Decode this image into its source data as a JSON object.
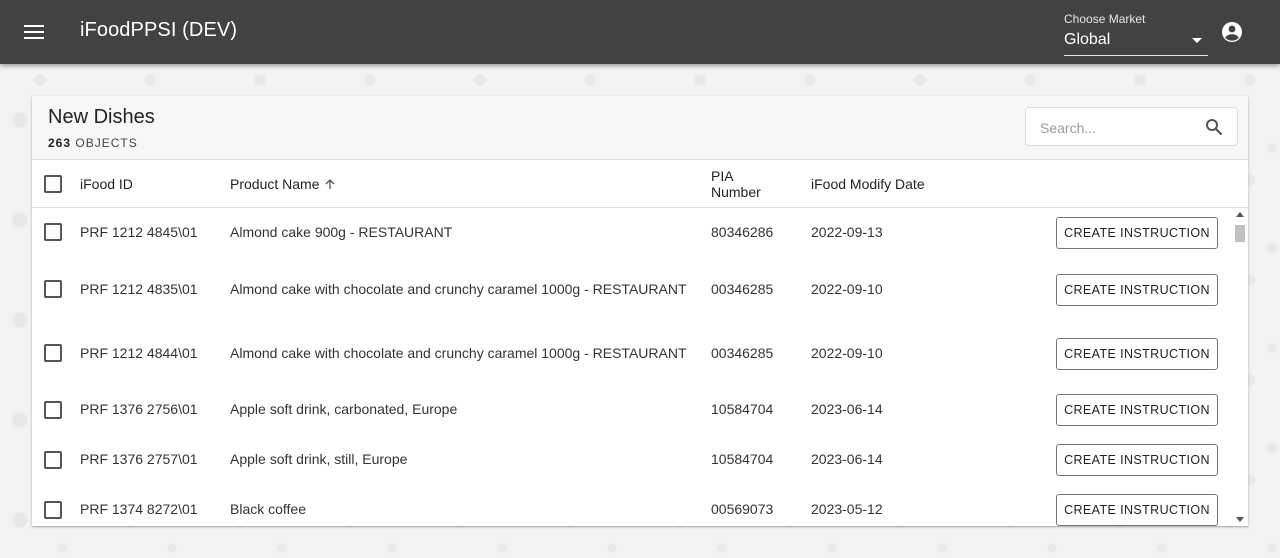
{
  "app": {
    "title": "iFoodPPSI (DEV)"
  },
  "market": {
    "label": "Choose Market",
    "value": "Global"
  },
  "card": {
    "title": "New Dishes",
    "count": "263",
    "count_suffix": "OBJECTS"
  },
  "search": {
    "placeholder": "Search..."
  },
  "table": {
    "headers": {
      "id": "iFood ID",
      "name": "Product Name",
      "pia_line1": "PIA",
      "pia_line2": "Number",
      "date": "iFood Modify Date"
    },
    "rows": [
      {
        "id": "PRF 1212 4845\\01",
        "name": "Almond cake 900g - RESTAURANT",
        "pia": "80346286",
        "date": "2022-09-13",
        "action": "CREATE INSTRUCTION"
      },
      {
        "id": "PRF 1212 4835\\01",
        "name": "Almond cake with chocolate and crunchy caramel 1000g - RESTAURANT",
        "pia": "00346285",
        "date": "2022-09-10",
        "action": "CREATE INSTRUCTION"
      },
      {
        "id": "PRF 1212 4844\\01",
        "name": "Almond cake with chocolate and crunchy caramel 1000g - RESTAURANT",
        "pia": "00346285",
        "date": "2022-09-10",
        "action": "CREATE INSTRUCTION"
      },
      {
        "id": "PRF 1376 2756\\01",
        "name": "Apple soft drink, carbonated, Europe",
        "pia": "10584704",
        "date": "2023-06-14",
        "action": "CREATE INSTRUCTION"
      },
      {
        "id": "PRF 1376 2757\\01",
        "name": "Apple soft drink, still, Europe",
        "pia": "10584704",
        "date": "2023-06-14",
        "action": "CREATE INSTRUCTION"
      },
      {
        "id": "PRF 1374 8272\\01",
        "name": "Black coffee",
        "pia": "00569073",
        "date": "2023-05-12",
        "action": "CREATE INSTRUCTION"
      }
    ]
  }
}
